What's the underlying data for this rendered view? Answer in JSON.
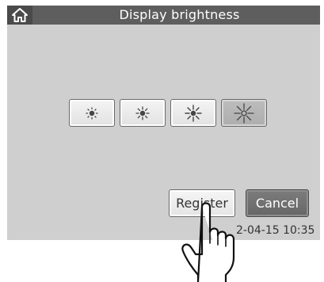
{
  "header": {
    "title": "Display brightness",
    "home_icon": "home-icon"
  },
  "brightness": {
    "levels": 4,
    "selected_level": 4,
    "icon": "sun-icon"
  },
  "actions": {
    "register_label": "Register",
    "cancel_label": "Cancel"
  },
  "status": {
    "datetime_visible": "2-04-15 10:35"
  },
  "colors": {
    "header_bg": "#5e5e5e",
    "screen_bg": "#cfcfcf",
    "selected_button": "#b4b4b4",
    "cancel_button": "#707070"
  }
}
